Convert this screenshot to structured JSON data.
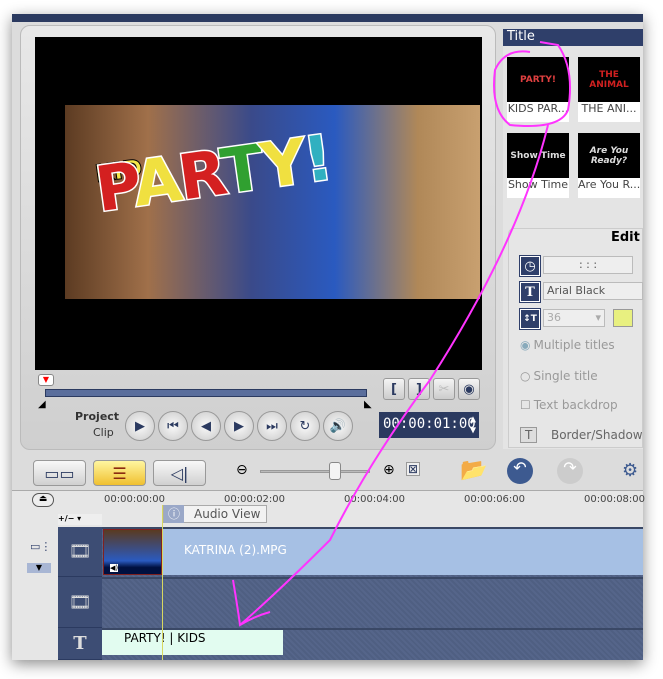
{
  "preview": {
    "project_label": "Project",
    "clip_label": "Clip",
    "timecode": "00:00:01:00",
    "overlay_kid": "KID",
    "overlay_party": [
      "P",
      "A",
      "R",
      "T",
      "Y",
      "!"
    ],
    "overlay_colors": [
      "#d42020",
      "#f0e040",
      "#d42020",
      "#30a030",
      "#f0e040",
      "#30b0c0"
    ]
  },
  "library": {
    "header": "Title",
    "items": [
      {
        "label": "KIDS PAR...",
        "thumb": "PARTY!"
      },
      {
        "label": "THE ANI...",
        "thumb": "THE ANIMAL"
      },
      {
        "label": "Show Time",
        "thumb": "Show Time"
      },
      {
        "label": "Are You R...",
        "thumb": "Are You Ready?"
      }
    ]
  },
  "edit": {
    "header": "Edit",
    "duration": ": : :",
    "font": "Arial Black",
    "size": "36",
    "color": "#e8f080",
    "multiple_titles": "Multiple titles",
    "single_title": "Single title",
    "text_backdrop": "Text backdrop",
    "border_shadow": "Border/Shadow"
  },
  "timeline": {
    "ticks": [
      "00:00:00:00",
      "00:00:02:00",
      "00:00:04:00",
      "00:00:06:00",
      "00:00:08:00"
    ],
    "tooltip": "Audio View",
    "add_remove": "+/−",
    "video_clip": "KATRINA (2).MPG",
    "title_clip": "PARTY! | KIDS"
  },
  "annotation_color": "#ff33ff"
}
